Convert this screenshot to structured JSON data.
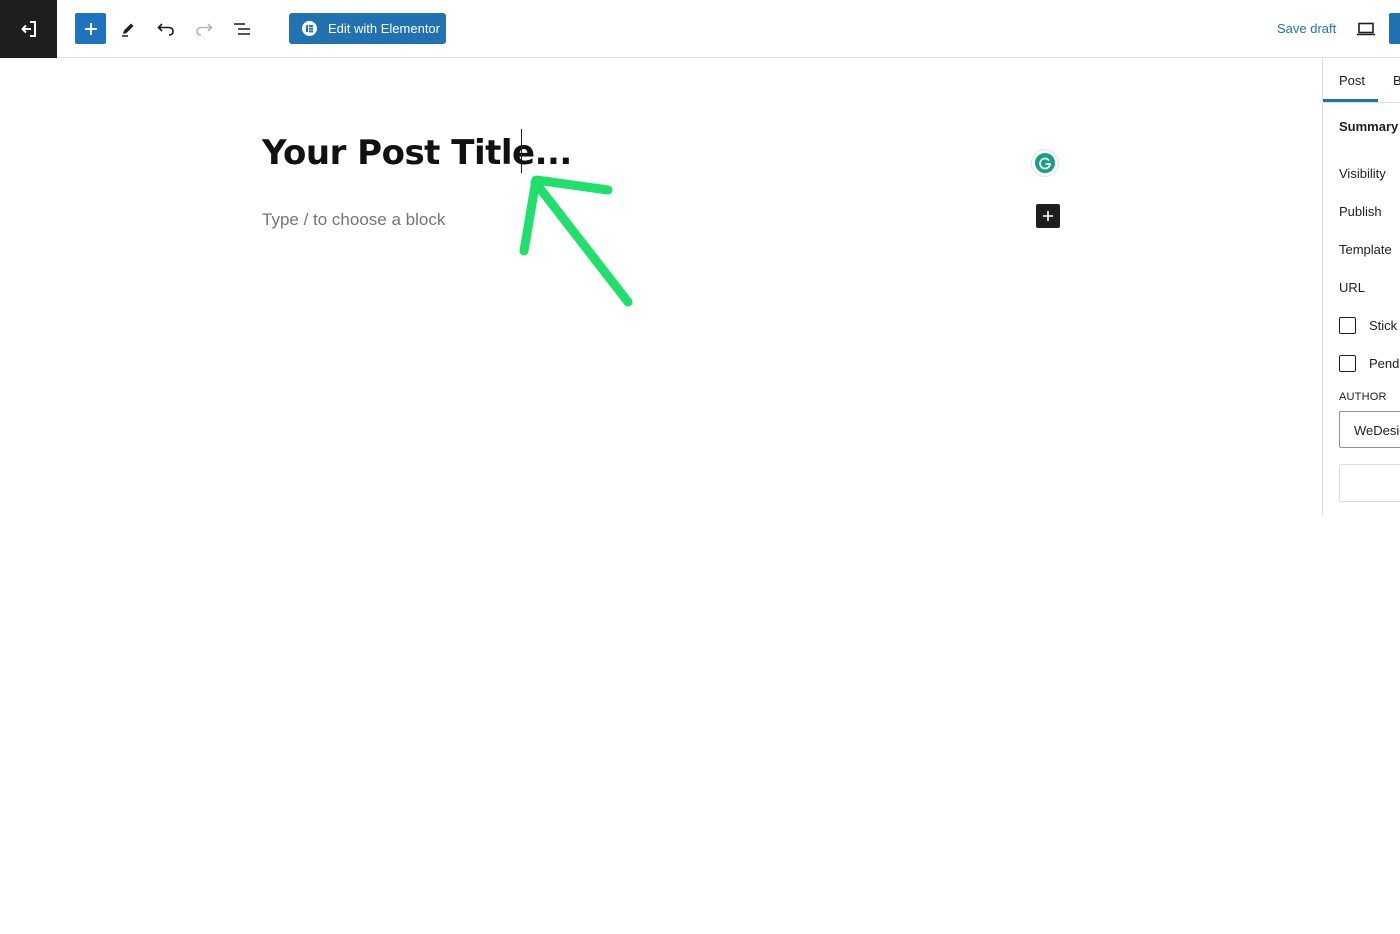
{
  "toolbar": {
    "exit_icon": "arrow-left-into-bracket-icon",
    "elementor_label": "Edit with Elementor",
    "save_draft_label": "Save draft"
  },
  "editor": {
    "title": "Your Post Title...",
    "placeholder": "Type / to choose a block"
  },
  "sidebar": {
    "tabs": [
      {
        "label": "Post",
        "active": true
      },
      {
        "label": "B",
        "active": false
      }
    ],
    "summary_title": "Summary",
    "rows": {
      "visibility": "Visibility",
      "publish": "Publish",
      "template": "Template",
      "url": "URL"
    },
    "checkboxes": {
      "sticky": "Stick t",
      "pending": "Pendi"
    },
    "author_label": "AUTHOR",
    "author_value": "WeDesig"
  },
  "colors": {
    "accent": "#2271b1",
    "annotation_arrow": "#1ee06a",
    "dark": "#1e1e1e",
    "grammarly": "#15a08a"
  }
}
